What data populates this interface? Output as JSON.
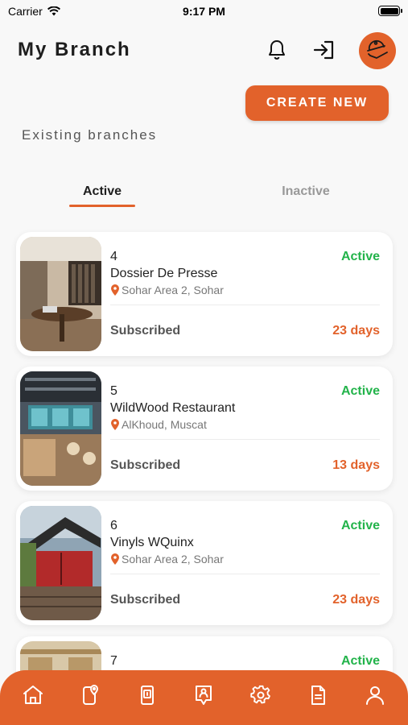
{
  "status_bar": {
    "carrier": "Carrier",
    "time": "9:17 PM"
  },
  "header": {
    "title": "My Branch"
  },
  "actions": {
    "create_label": "CREATE NEW"
  },
  "section": {
    "title": "Existing branches"
  },
  "tabs": [
    {
      "label": "Active",
      "selected": true
    },
    {
      "label": "Inactive",
      "selected": false
    }
  ],
  "branches": [
    {
      "id": "4",
      "name": "Dossier De Presse",
      "location": "Sohar Area 2, Sohar",
      "status": "Active",
      "subscription": "Subscribed",
      "days": "23 days"
    },
    {
      "id": "5",
      "name": "WildWood Restaurant",
      "location": "AlKhoud, Muscat",
      "status": "Active",
      "subscription": "Subscribed",
      "days": "13 days"
    },
    {
      "id": "6",
      "name": "Vinyls WQuinx",
      "location": "Sohar Area 2, Sohar",
      "status": "Active",
      "subscription": "Subscribed",
      "days": "23 days"
    },
    {
      "id": "7",
      "status": "Active"
    }
  ],
  "colors": {
    "accent": "#e2622b",
    "active_status": "#22b34a",
    "background": "#f8f8f8"
  },
  "bottom_nav": [
    {
      "icon": "home-icon"
    },
    {
      "icon": "phone-location-icon"
    },
    {
      "icon": "branch-card-icon"
    },
    {
      "icon": "staff-badge-icon"
    },
    {
      "icon": "settings-icon"
    },
    {
      "icon": "document-icon"
    },
    {
      "icon": "profile-icon"
    }
  ]
}
